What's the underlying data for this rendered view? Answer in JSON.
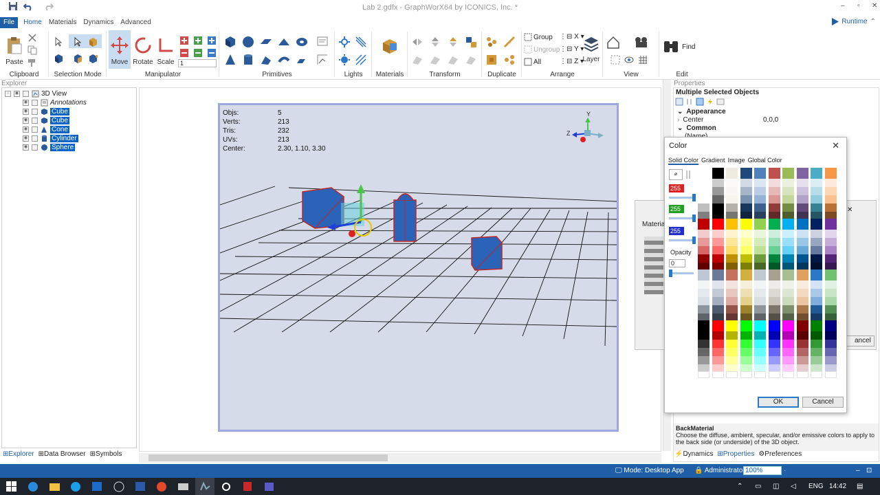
{
  "window": {
    "title": "Lab 2.gdfx - GraphWorX64 by ICONICS, Inc. *"
  },
  "ribbon": {
    "tabs": [
      {
        "label": "File"
      },
      {
        "label": "Home"
      },
      {
        "label": "Materials"
      },
      {
        "label": "Dynamics"
      },
      {
        "label": "Advanced"
      }
    ],
    "runtime_label": "Runtime",
    "groups": {
      "clipboard": "Clipboard",
      "selection_mode": "Selection Mode",
      "manipulator": "Manipulator",
      "primitives": "Primitives",
      "lights": "Lights",
      "materials": "Materials",
      "transform": "Transform",
      "duplicate": "Duplicate",
      "arrange": "Arrange",
      "view": "View",
      "edit": "Edit"
    },
    "buttons": {
      "paste": "Paste",
      "move": "Move",
      "rotate": "Rotate",
      "scale": "Scale",
      "scale_value": "1",
      "group": "Group",
      "ungroup": "Ungroup",
      "all": "All",
      "x": "X",
      "y": "Y",
      "z": "Z",
      "layer": "Layer",
      "find": "Find"
    }
  },
  "explorer": {
    "title": "Explorer",
    "root": "3D View",
    "annotations": "Annotations",
    "items": [
      {
        "label": "Cube",
        "icon": "cube-icon"
      },
      {
        "label": "Cube",
        "icon": "cube-icon"
      },
      {
        "label": "Cone",
        "icon": "cone-icon"
      },
      {
        "label": "Cylinder",
        "icon": "cylinder-icon"
      },
      {
        "label": "Sphere",
        "icon": "sphere-icon"
      }
    ],
    "bottom_tabs": [
      "Explorer",
      "Data Browser",
      "Symbols"
    ]
  },
  "viewport": {
    "stats": [
      {
        "key": "Objs:",
        "value": "5"
      },
      {
        "key": "Verts:",
        "value": "213"
      },
      {
        "key": "Tris:",
        "value": "232"
      },
      {
        "key": "UVs:",
        "value": "213"
      },
      {
        "key": "Center:",
        "value": "2.30, 1.10, 3.30"
      }
    ],
    "axis_labels": {
      "y": "Y",
      "z": "Z"
    }
  },
  "properties": {
    "header": "Properties",
    "title": "Multiple Selected Objects",
    "appearance": "Appearance",
    "center_label": "Center",
    "center_value": "0,0,0",
    "common": "Common",
    "name_row": "(Name)",
    "description_title": "BackMaterial",
    "description": "Choose the diffuse, ambient, specular, and/or emissive colors to apply to the back side (or underside) of the 3D object.",
    "bottom_tabs": [
      "Dynamics",
      "Properties",
      "Preferences"
    ]
  },
  "background_dialog": {
    "label": "Materia",
    "cancel_fragment": "ancel"
  },
  "color_dialog": {
    "title": "Color",
    "tabs": [
      "Solid Color",
      "Gradient",
      "Image",
      "Global Color"
    ],
    "red": "255",
    "green": "255",
    "blue": "255",
    "opacity_label": "Opacity",
    "opacity_value": "0",
    "ok": "OK",
    "cancel": "Cancel",
    "colors": {
      "red_channel": "#e02020",
      "green_channel": "#20a020",
      "blue_channel": "#2030d0"
    }
  },
  "statusbar": {
    "mode": "Mode: Desktop App",
    "user": "Administrator",
    "zoom": "100%"
  },
  "taskbar": {
    "language": "ENG",
    "time": "14:42"
  }
}
